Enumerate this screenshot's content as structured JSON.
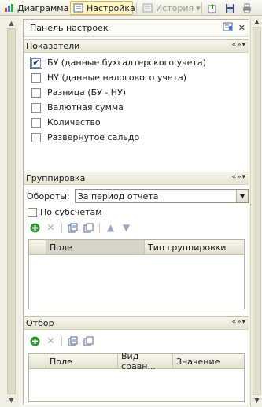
{
  "toolbar": {
    "diagram_label": "Диаграмма",
    "settings_label": "Настройка",
    "history_label": "История",
    "history_arrow": "▾"
  },
  "panel": {
    "title": "Панель настроек"
  },
  "indicators": {
    "header": "Показатели",
    "items": [
      {
        "label": "БУ (данные бухгалтерского учета)",
        "checked": true
      },
      {
        "label": "НУ (данные налогового учета)",
        "checked": false
      },
      {
        "label": "Разница (БУ - НУ)",
        "checked": false
      },
      {
        "label": "Валютная сумма",
        "checked": false
      },
      {
        "label": "Количество",
        "checked": false
      },
      {
        "label": "Развернутое сальдо",
        "checked": false
      }
    ]
  },
  "grouping": {
    "header": "Группировка",
    "turnover_label": "Обороты:",
    "turnover_value": "За период отчета",
    "subaccounts_label": "По субсчетам",
    "columns": [
      "Поле",
      "Тип группировки"
    ]
  },
  "filter": {
    "header": "Отбор",
    "columns": [
      "Поле",
      "Вид сравн...",
      "Значение"
    ]
  },
  "glyphs": {
    "checkmark": "✔",
    "nav": "«»▾",
    "close": "✕",
    "up": "▲",
    "down": "▼"
  },
  "colors": {
    "accent": "#d6b95a",
    "add_green": "#2f9a2f",
    "panel_border": "#b9b6a0"
  }
}
